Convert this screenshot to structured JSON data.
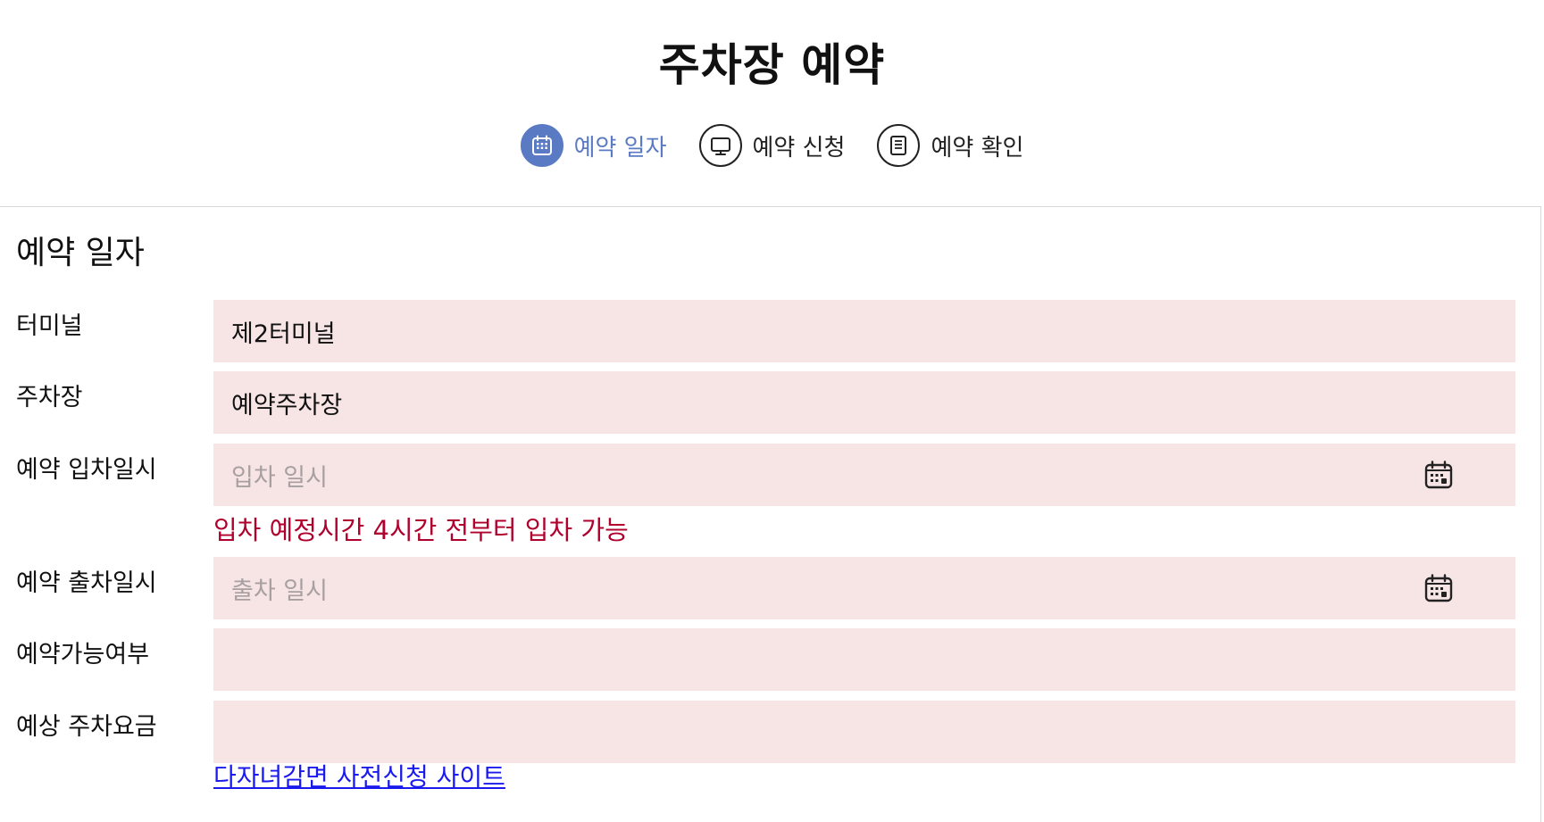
{
  "page": {
    "title": "주차장 예약"
  },
  "steps": [
    {
      "label": "예약 일자",
      "icon": "calendar-icon",
      "active": true
    },
    {
      "label": "예약 신청",
      "icon": "monitor-icon",
      "active": false
    },
    {
      "label": "예약 확인",
      "icon": "document-icon",
      "active": false
    }
  ],
  "colors": {
    "accent": "#5b7ac4",
    "field_bg": "#f7e5e6",
    "notice": "#b0002d",
    "link": "#1a1aee"
  },
  "form": {
    "section_title": "예약 일자",
    "terminal": {
      "label": "터미널",
      "value": "제2터미널"
    },
    "parking": {
      "label": "주차장",
      "value": "예약주차장"
    },
    "entry": {
      "label": "예약 입차일시",
      "placeholder": "입차 일시",
      "icon": "calendar-icon"
    },
    "entry_notice": "입차 예정시간 4시간 전부터 입차 가능",
    "exit": {
      "label": "예약 출차일시",
      "placeholder": "출차 일시",
      "icon": "calendar-icon"
    },
    "availability": {
      "label": "예약가능여부",
      "value": ""
    },
    "fee": {
      "label": "예상 주차요금",
      "value": ""
    }
  },
  "link": {
    "label": "다자녀감면 사전신청 사이트"
  }
}
